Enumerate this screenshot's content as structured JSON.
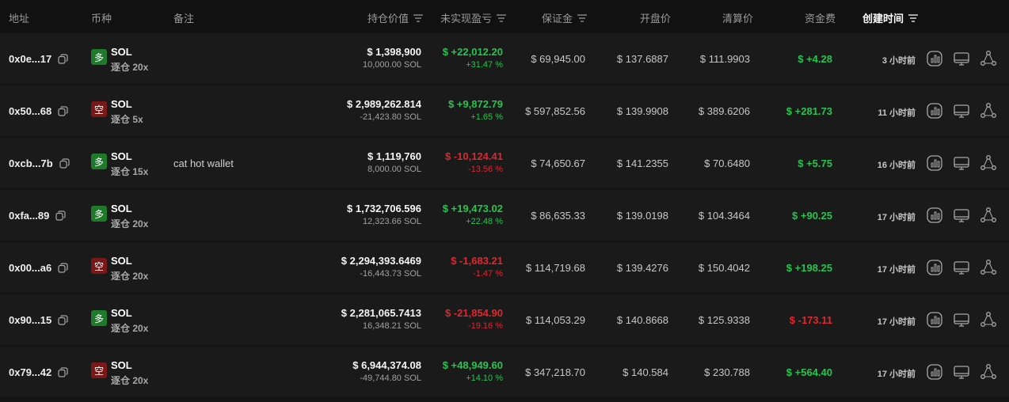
{
  "header": {
    "address": "地址",
    "coin": "币种",
    "note": "备注",
    "value": "持仓价值",
    "pnl": "未实现盈亏",
    "margin": "保证金",
    "open_price": "开盘价",
    "liq_price": "清算价",
    "funding": "资金费",
    "created": "创建时间"
  },
  "colors": {
    "background": "#141414",
    "row": "#1a1a1a",
    "header": "#111111",
    "green": "#27c44f",
    "red": "#e0262e",
    "long_badge": "#1f7a2c",
    "short_badge": "#7a1717"
  },
  "icons": {
    "copy": "copy-icon",
    "filter": "filter-icon",
    "chart": "bar-chart-icon",
    "monitor": "monitor-icon",
    "network": "share-network-icon"
  },
  "rows": [
    {
      "address": "0x0e...17",
      "side": "多",
      "side_type": "long",
      "coin": "SOL",
      "leverage": "逐仓 20x",
      "note": "",
      "value": "$ 1,398,900",
      "size": "10,000.00 SOL",
      "pnl": "$ +22,012.20",
      "pnl_pct": "+31.47 %",
      "pnl_dir": "green",
      "margin": "$ 69,945.00",
      "open": "$ 137.6887",
      "liq": "$ 111.9903",
      "funding": "$ +4.28",
      "funding_dir": "green",
      "time": "3 小时前"
    },
    {
      "address": "0x50...68",
      "side": "空",
      "side_type": "short",
      "coin": "SOL",
      "leverage": "逐仓 5x",
      "note": "",
      "value": "$ 2,989,262.814",
      "size": "-21,423.80 SOL",
      "pnl": "$ +9,872.79",
      "pnl_pct": "+1.65 %",
      "pnl_dir": "green",
      "margin": "$ 597,852.56",
      "open": "$ 139.9908",
      "liq": "$ 389.6206",
      "funding": "$ +281.73",
      "funding_dir": "green",
      "time": "11 小时前"
    },
    {
      "address": "0xcb...7b",
      "side": "多",
      "side_type": "long",
      "coin": "SOL",
      "leverage": "逐仓 15x",
      "note": "cat hot wallet",
      "value": "$ 1,119,760",
      "size": "8,000.00 SOL",
      "pnl": "$ -10,124.41",
      "pnl_pct": "-13.56 %",
      "pnl_dir": "red",
      "margin": "$ 74,650.67",
      "open": "$ 141.2355",
      "liq": "$ 70.6480",
      "funding": "$ +5.75",
      "funding_dir": "green",
      "time": "16 小时前"
    },
    {
      "address": "0xfa...89",
      "side": "多",
      "side_type": "long",
      "coin": "SOL",
      "leverage": "逐仓 20x",
      "note": "",
      "value": "$ 1,732,706.596",
      "size": "12,323.66 SOL",
      "pnl": "$ +19,473.02",
      "pnl_pct": "+22.48 %",
      "pnl_dir": "green",
      "margin": "$ 86,635.33",
      "open": "$ 139.0198",
      "liq": "$ 104.3464",
      "funding": "$ +90.25",
      "funding_dir": "green",
      "time": "17 小时前"
    },
    {
      "address": "0x00...a6",
      "side": "空",
      "side_type": "short",
      "coin": "SOL",
      "leverage": "逐仓 20x",
      "note": "",
      "value": "$ 2,294,393.6469",
      "size": "-16,443.73 SOL",
      "pnl": "$ -1,683.21",
      "pnl_pct": "-1.47 %",
      "pnl_dir": "red",
      "margin": "$ 114,719.68",
      "open": "$ 139.4276",
      "liq": "$ 150.4042",
      "funding": "$ +198.25",
      "funding_dir": "green",
      "time": "17 小时前"
    },
    {
      "address": "0x90...15",
      "side": "多",
      "side_type": "long",
      "coin": "SOL",
      "leverage": "逐仓 20x",
      "note": "",
      "value": "$ 2,281,065.7413",
      "size": "16,348.21 SOL",
      "pnl": "$ -21,854.90",
      "pnl_pct": "-19.16 %",
      "pnl_dir": "red",
      "margin": "$ 114,053.29",
      "open": "$ 140.8668",
      "liq": "$ 125.9338",
      "funding": "$ -173.11",
      "funding_dir": "red",
      "time": "17 小时前"
    },
    {
      "address": "0x79...42",
      "side": "空",
      "side_type": "short",
      "coin": "SOL",
      "leverage": "逐仓 20x",
      "note": "",
      "value": "$ 6,944,374.08",
      "size": "-49,744.80 SOL",
      "pnl": "$ +48,949.60",
      "pnl_pct": "+14.10 %",
      "pnl_dir": "green",
      "margin": "$ 347,218.70",
      "open": "$ 140.584",
      "liq": "$ 230.788",
      "funding": "$ +564.40",
      "funding_dir": "green",
      "time": "17 小时前"
    }
  ]
}
